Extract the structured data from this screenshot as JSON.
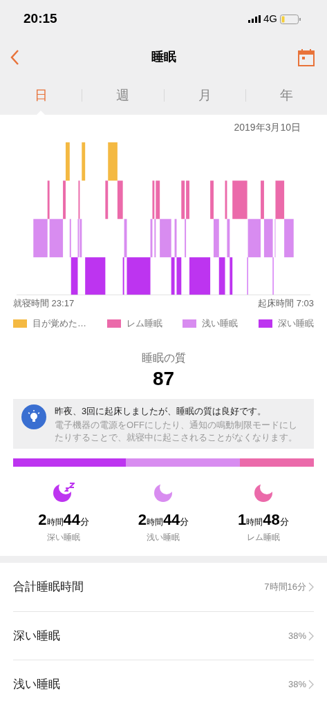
{
  "status_bar": {
    "time": "20:15",
    "network": "4G"
  },
  "nav": {
    "title": "睡眠"
  },
  "tabs": [
    {
      "label": "日",
      "selected": true
    },
    {
      "label": "週",
      "selected": false
    },
    {
      "label": "月",
      "selected": false
    },
    {
      "label": "年",
      "selected": false
    }
  ],
  "date": "2019年3月10日",
  "chart": {
    "bedtime": "就寝時間 23:17",
    "wake_time": "起床時間 7:03"
  },
  "legend": [
    {
      "label": "目が覚めた…",
      "color": "#f4b942"
    },
    {
      "label": "レム睡眠",
      "color": "#eb6aaa"
    },
    {
      "label": "浅い睡眠",
      "color": "#d88cf0"
    },
    {
      "label": "深い睡眠",
      "color": "#bd34f0"
    }
  ],
  "quality": {
    "label": "睡眠の質",
    "score": "87"
  },
  "tip": {
    "title": "昨夜、3回に起床しましたが、睡眠の質は良好です。",
    "body": "電子機器の電源をOFFにしたり、通知の鳴動制限モードにしたりすることで、就寝中に起こされることがなくなります。"
  },
  "stages": [
    {
      "hours": "2",
      "hour_unit": "時間",
      "minutes": "44",
      "minute_unit": "分",
      "label": "深い睡眠",
      "color": "#bd34f0",
      "sleeping_marks": true
    },
    {
      "hours": "2",
      "hour_unit": "時間",
      "minutes": "44",
      "minute_unit": "分",
      "label": "浅い睡眠",
      "color": "#d88cf0",
      "sleeping_marks": false
    },
    {
      "hours": "1",
      "hour_unit": "時間",
      "minutes": "48",
      "minute_unit": "分",
      "label": "レム睡眠",
      "color": "#eb6aaa",
      "sleeping_marks": false
    }
  ],
  "rows": [
    {
      "label": "合計睡眠時間",
      "value": "7時間16分"
    },
    {
      "label": "深い睡眠",
      "value": "38%"
    },
    {
      "label": "浅い睡眠",
      "value": "38%"
    }
  ]
}
